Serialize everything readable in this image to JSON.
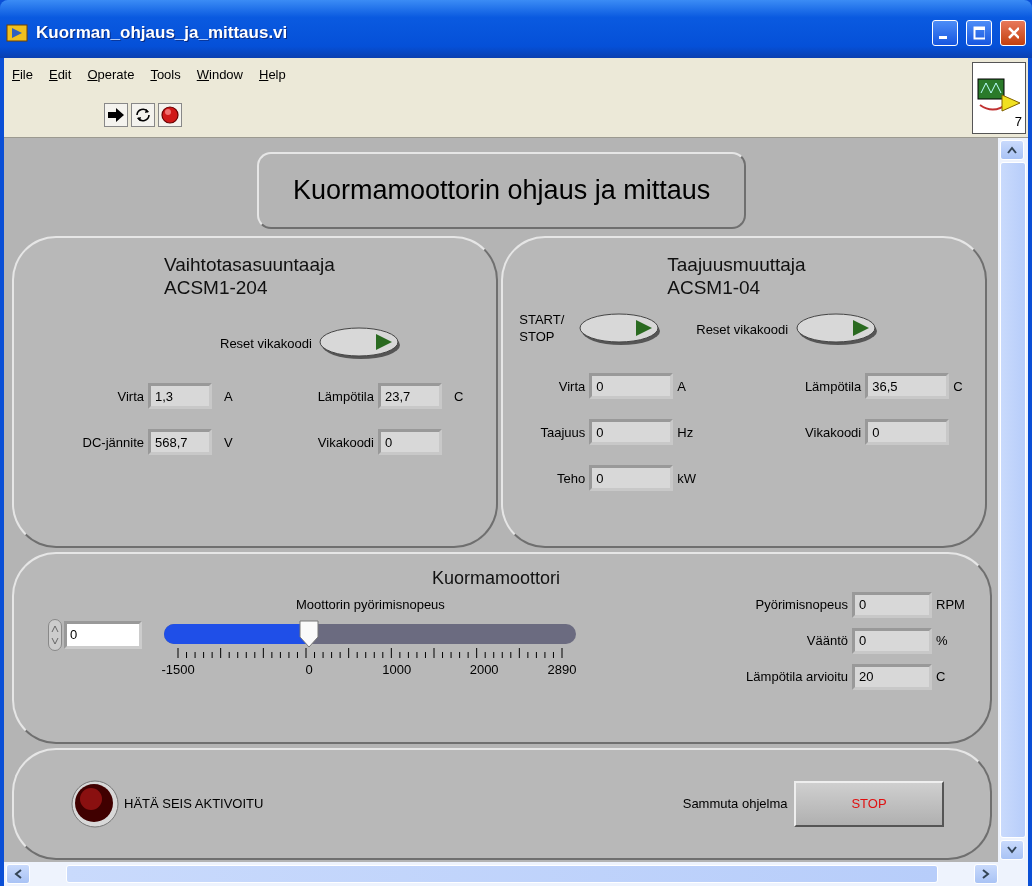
{
  "window": {
    "title": "Kuorman_ohjaus_ja_mittaus.vi"
  },
  "menu": [
    "File",
    "Edit",
    "Operate",
    "Tools",
    "Window",
    "Help"
  ],
  "vi_icon": {
    "number": "7"
  },
  "heading": "Kuormamoottorin ohjaus ja mittaus",
  "panels": [
    {
      "title": "Vaihtotasasuuntaaja",
      "subtitle": "ACSM1-204",
      "buttons": [
        {
          "label": "Reset vikakoodi"
        }
      ],
      "left": [
        {
          "label": "Virta",
          "value": "1,3",
          "unit": "A"
        },
        {
          "label": "DC-jännite",
          "value": "568,7",
          "unit": "V"
        }
      ],
      "right": [
        {
          "label": "Lämpötila",
          "value": "23,7",
          "unit": "C"
        },
        {
          "label": "Vikakoodi",
          "value": "0"
        }
      ]
    },
    {
      "title": "Taajuusmuuttaja",
      "subtitle": "ACSM1-04",
      "buttons": [
        {
          "label": "START/ STOP"
        },
        {
          "label": "Reset vikakoodi"
        }
      ],
      "left": [
        {
          "label": "Virta",
          "value": "0",
          "unit": "A"
        },
        {
          "label": "Taajuus",
          "value": "0",
          "unit": "Hz"
        },
        {
          "label": "Teho",
          "value": "0",
          "unit": "kW"
        }
      ],
      "right": [
        {
          "label": "Lämpötila",
          "value": "36,5",
          "unit": "C"
        },
        {
          "label": "Vikakoodi",
          "value": "0"
        }
      ]
    }
  ],
  "motor": {
    "title": "Kuormamoottori",
    "numeric_value": "0",
    "slider_label": "Moottorin pyörimisnopeus",
    "level": 0.342,
    "ticks": [
      "-1500",
      "0",
      "1000",
      "2000",
      "2890"
    ],
    "readouts": [
      {
        "label": "Pyörimisnopeus",
        "value": "0",
        "unit": "RPM"
      },
      {
        "label": "Vääntö",
        "value": "0",
        "unit": "%"
      },
      {
        "label": "Lämpötila arvioitu",
        "value": "20",
        "unit": "C"
      }
    ]
  },
  "emergency": {
    "lit": false,
    "label": "HÄTÄ SEIS AKTIVOITU"
  },
  "shutdown": {
    "label": "Sammuta ohjelma",
    "button": "STOP"
  }
}
